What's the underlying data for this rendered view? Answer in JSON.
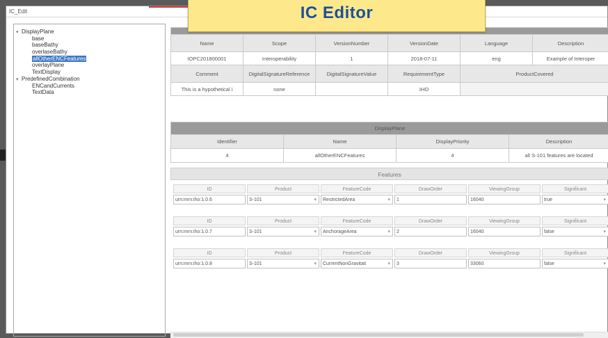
{
  "window": {
    "title": "IC_Edit"
  },
  "banner": {
    "title": "IC  Editor"
  },
  "tree": {
    "items": [
      {
        "label": "DisplayPlane",
        "level": 0,
        "expanded": true
      },
      {
        "label": "base",
        "level": 1
      },
      {
        "label": "baseBathy",
        "level": 1
      },
      {
        "label": "overlaseBathy",
        "level": 1
      },
      {
        "label": "allOtherENCFeatures",
        "level": 1,
        "selected": true
      },
      {
        "label": "overlayPlane",
        "level": 1
      },
      {
        "label": "TextDisplay",
        "level": 1
      },
      {
        "label": "PredefinedCombination",
        "level": 0,
        "expanded": true
      },
      {
        "label": "ENCandCurrents",
        "level": 1
      },
      {
        "label": "TextData",
        "level": 1
      }
    ]
  },
  "header": {
    "row1_headers": [
      "Name",
      "Scope",
      "VersionNumber",
      "VersionDate",
      "Language",
      "Description"
    ],
    "row1_values": [
      "IOPC201800001",
      "Interoperability",
      "1",
      "2018-07-11",
      "eng",
      "Example of Interoper"
    ],
    "row2_headers": [
      "Comment",
      "DigitalSignatureReference",
      "DigitalSignatureValue",
      "RequirementType",
      "ProductCovered"
    ],
    "row2_values": [
      "This is a hypothetical i",
      "none",
      "",
      "IHO",
      ""
    ]
  },
  "displayPlane": {
    "title": "DisplayPlane",
    "headers": [
      "Identifier",
      "Name",
      "DisplayPriority",
      "Description"
    ],
    "values": [
      "4",
      "allOtherENCFeatures",
      "4",
      "all S-101 features are located"
    ]
  },
  "features": {
    "title": "Features",
    "labels": [
      "ID",
      "Product",
      "FeatureCode",
      "DrawOrder",
      "ViewingGroup",
      "Significant"
    ],
    "rows": [
      {
        "id": "urn:mrn:iho:1.0.6",
        "product": "S-101",
        "featureCode": "RestrictedArea",
        "drawOrder": "1",
        "viewingGroup": "16040",
        "significant": "true"
      },
      {
        "id": "urn:mrn:iho:1.0.7",
        "product": "S-101",
        "featureCode": "AnchorageArea",
        "drawOrder": "2",
        "viewingGroup": "16040",
        "significant": "false"
      },
      {
        "id": "urn:mrn:iho:1.0.8",
        "product": "S-101",
        "featureCode": "CurrentNonGravitati",
        "drawOrder": "3",
        "viewingGroup": "33060",
        "significant": "false"
      }
    ]
  }
}
